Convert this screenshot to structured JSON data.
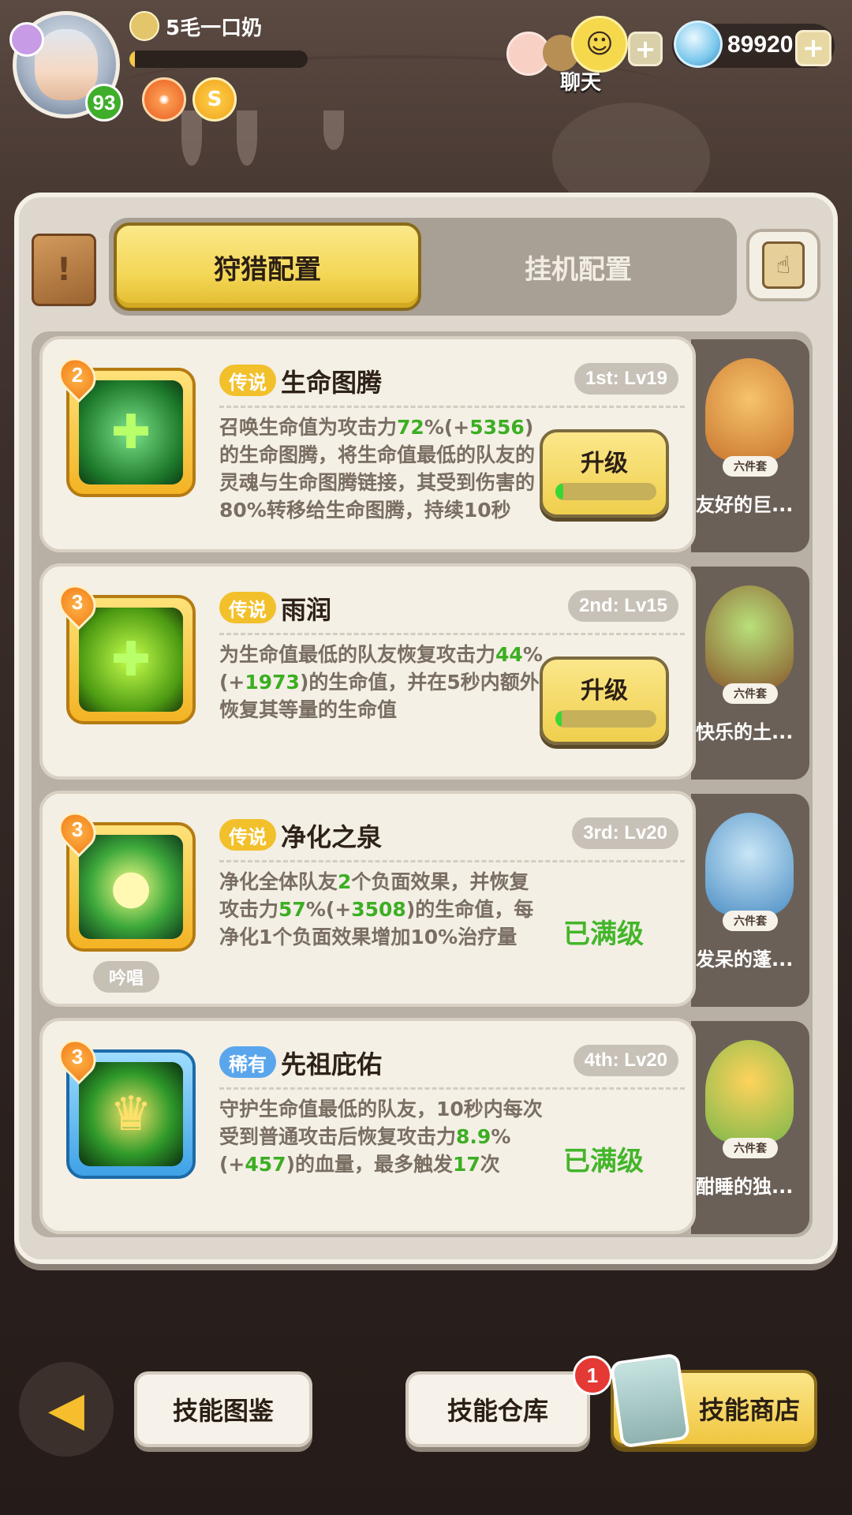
{
  "player": {
    "name": "5毛一口奶",
    "level": "93",
    "exp_fraction": 0.03
  },
  "header": {
    "chat_label": "聊天",
    "currency_value": "89920",
    "plus_icon": "plus-icon"
  },
  "tabs": [
    {
      "label": "狩猎配置",
      "active": true
    },
    {
      "label": "挂机配置",
      "active": false
    }
  ],
  "skills": [
    {
      "slot_number": "2",
      "rarity": "传说",
      "name": "生命图腾",
      "slot_level": "1st: Lv19",
      "desc_parts": [
        "召唤生命值为攻击力",
        "72",
        "%(+",
        "5356",
        ")的生命图腾，将生命值最低的队友的灵魂与生命图腾链接，其受到伤害的80%转移给生命图腾，持续10秒"
      ],
      "action": "升级",
      "upgrade_progress": 0.08,
      "icon": "totem-icon",
      "side_badge": "六件套",
      "side_name": "友好的巨..."
    },
    {
      "slot_number": "3",
      "rarity": "传说",
      "name": "雨润",
      "slot_level": "2nd: Lv15",
      "desc_parts": [
        "为生命值最低的队友恢复攻击力",
        "44",
        "%(+",
        "1973",
        ")的生命值，并在5秒内额外恢复其等量的生命值"
      ],
      "action": "升级",
      "upgrade_progress": 0.04,
      "icon": "heal-rain-icon",
      "side_badge": "六件套",
      "side_name": "快乐的土..."
    },
    {
      "slot_number": "3",
      "rarity": "传说",
      "name": "净化之泉",
      "slot_level": "3rd: Lv20",
      "desc_parts": [
        "净化全体队友",
        "2",
        "个负面效果，并恢复攻击力",
        "57",
        "%(+",
        "3508",
        ")的生命值，每净化1个负面效果增加10%治疗量"
      ],
      "status": "已满级",
      "chant": "吟唱",
      "icon": "spring-drop-icon",
      "side_badge": "六件套",
      "side_name": "发呆的蓬..."
    },
    {
      "slot_number": "3",
      "rarity": "稀有",
      "name": "先祖庇佑",
      "slot_level": "4th: Lv20",
      "desc_parts": [
        "守护生命值最低的队友，10秒内每次受到普通攻击后恢复攻击力",
        "8.9",
        "%(+",
        "457",
        ")的血量，最多触发",
        "17",
        "次"
      ],
      "status": "已满级",
      "icon": "shield-crown-icon",
      "side_badge": "六件套",
      "side_name": "酣睡的独..."
    }
  ],
  "footer": {
    "guide_label": "技能图鉴",
    "storage_label": "技能仓库",
    "storage_badge": "1",
    "shop_label": "技能商店"
  },
  "colors": {
    "accent_yellow": "#f4d756",
    "green_value": "#3cae23",
    "legend_tag": "#f2c02b",
    "rare_tag": "#5aa6ec"
  }
}
